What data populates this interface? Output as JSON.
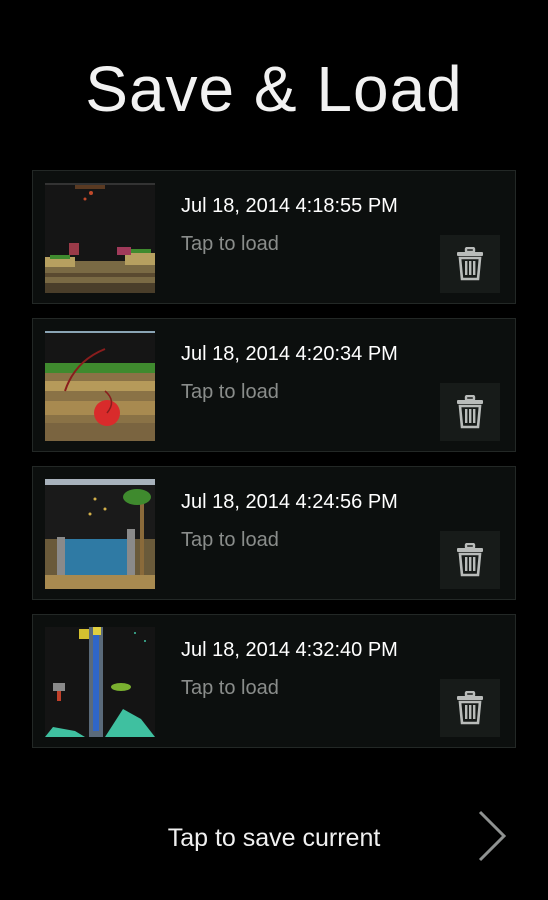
{
  "title": "Save & Load",
  "slots": [
    {
      "date": "Jul 18, 2014 4:18:55 PM",
      "hint": "Tap to load"
    },
    {
      "date": "Jul 18, 2014 4:20:34 PM",
      "hint": "Tap to load"
    },
    {
      "date": "Jul 18, 2014 4:24:56 PM",
      "hint": "Tap to load"
    },
    {
      "date": "Jul 18, 2014 4:32:40 PM",
      "hint": "Tap to load"
    }
  ],
  "footer": {
    "save_label": "Tap to save current"
  },
  "icons": {
    "delete": "trash-icon",
    "next": "chevron-right-icon"
  }
}
